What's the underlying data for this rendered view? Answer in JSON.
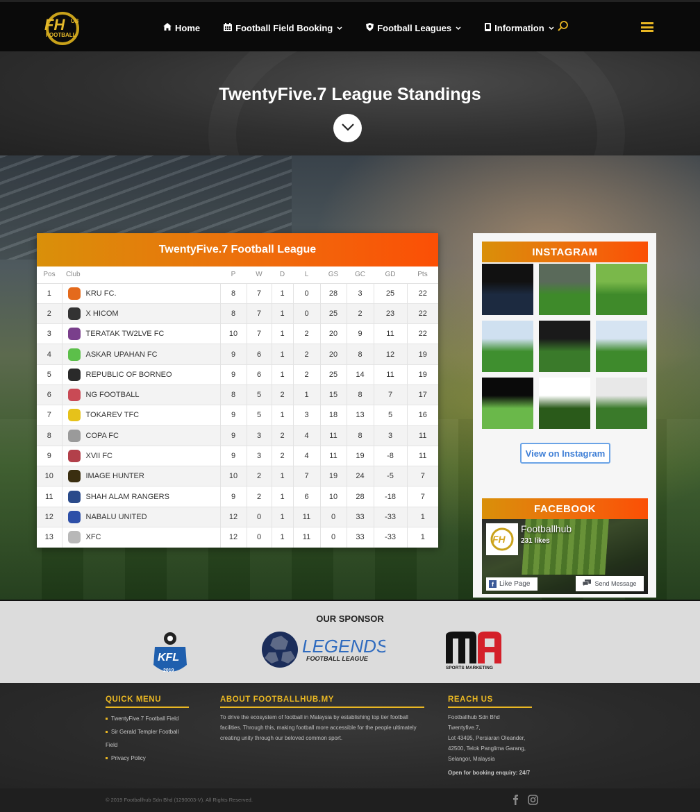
{
  "header": {
    "logo_alt": "Football Hub",
    "nav": [
      {
        "label": "Home",
        "icon": "home-icon",
        "dropdown": false
      },
      {
        "label": "Football Field Booking",
        "icon": "calendar-icon",
        "dropdown": true
      },
      {
        "label": "Football Leagues",
        "icon": "shield-icon",
        "dropdown": true
      },
      {
        "label": "Information",
        "icon": "tablet-icon",
        "dropdown": true
      }
    ],
    "accent": "#e9b723"
  },
  "hero": {
    "title": "TwentyFive.7 League Standings"
  },
  "standings": {
    "title": "TwentyFive.7 Football League",
    "columns": [
      "Pos",
      "Club",
      "P",
      "W",
      "D",
      "L",
      "GS",
      "GC",
      "GD",
      "Pts"
    ],
    "rows": [
      {
        "pos": "1",
        "club": "KRU FC.",
        "p": "8",
        "w": "7",
        "d": "1",
        "l": "0",
        "gs": "28",
        "gc": "3",
        "gd": "25",
        "pts": "22",
        "crest": "#e46a1c"
      },
      {
        "pos": "2",
        "club": "X HICOM",
        "p": "8",
        "w": "7",
        "d": "1",
        "l": "0",
        "gs": "25",
        "gc": "2",
        "gd": "23",
        "pts": "22",
        "crest": "#333333"
      },
      {
        "pos": "3",
        "club": "TERATAK TW2LVE FC",
        "p": "10",
        "w": "7",
        "d": "1",
        "l": "2",
        "gs": "20",
        "gc": "9",
        "gd": "11",
        "pts": "22",
        "crest": "#7a3f8c"
      },
      {
        "pos": "4",
        "club": "ASKAR UPAHAN FC",
        "p": "9",
        "w": "6",
        "d": "1",
        "l": "2",
        "gs": "20",
        "gc": "8",
        "gd": "12",
        "pts": "19",
        "crest": "#5cbf4a"
      },
      {
        "pos": "5",
        "club": "REPUBLIC OF BORNEO",
        "p": "9",
        "w": "6",
        "d": "1",
        "l": "2",
        "gs": "25",
        "gc": "14",
        "gd": "11",
        "pts": "19",
        "crest": "#2a2a2a"
      },
      {
        "pos": "6",
        "club": "NG FOOTBALL",
        "p": "8",
        "w": "5",
        "d": "2",
        "l": "1",
        "gs": "15",
        "gc": "8",
        "gd": "7",
        "pts": "17",
        "crest": "#c94a55"
      },
      {
        "pos": "7",
        "club": "TOKAREV TFC",
        "p": "9",
        "w": "5",
        "d": "1",
        "l": "3",
        "gs": "18",
        "gc": "13",
        "gd": "5",
        "pts": "16",
        "crest": "#e6c21a"
      },
      {
        "pos": "8",
        "club": "COPA FC",
        "p": "9",
        "w": "3",
        "d": "2",
        "l": "4",
        "gs": "11",
        "gc": "8",
        "gd": "3",
        "pts": "11",
        "crest": "#9a9a9a"
      },
      {
        "pos": "9",
        "club": "XVII FC",
        "p": "9",
        "w": "3",
        "d": "2",
        "l": "4",
        "gs": "11",
        "gc": "19",
        "gd": "-8",
        "pts": "11",
        "crest": "#b2404a"
      },
      {
        "pos": "10",
        "club": "IMAGE HUNTER",
        "p": "10",
        "w": "2",
        "d": "1",
        "l": "7",
        "gs": "19",
        "gc": "24",
        "gd": "-5",
        "pts": "7",
        "crest": "#3a2e10"
      },
      {
        "pos": "11",
        "club": "SHAH ALAM RANGERS",
        "p": "9",
        "w": "2",
        "d": "1",
        "l": "6",
        "gs": "10",
        "gc": "28",
        "gd": "-18",
        "pts": "7",
        "crest": "#2a4a8a"
      },
      {
        "pos": "12",
        "club": "NABALU UNITED",
        "p": "12",
        "w": "0",
        "d": "1",
        "l": "11",
        "gs": "0",
        "gc": "33",
        "gd": "-33",
        "pts": "1",
        "crest": "#2d4fa8"
      },
      {
        "pos": "13",
        "club": "XFC",
        "p": "12",
        "w": "0",
        "d": "1",
        "l": "11",
        "gs": "0",
        "gc": "33",
        "gd": "-33",
        "pts": "1",
        "crest": "#b8b8b8"
      }
    ]
  },
  "instagram": {
    "title": "INSTAGRAM",
    "tiles": [
      {
        "label": "promo-poster",
        "colors": [
          "#111",
          "#1c2a40"
        ]
      },
      {
        "label": "field-evening",
        "colors": [
          "#5a6a5a",
          "#3e8a2a"
        ]
      },
      {
        "label": "field-stripes",
        "colors": [
          "#7ab84a",
          "#3f8a2a"
        ]
      },
      {
        "label": "field-day-1",
        "colors": [
          "#cfe0f0",
          "#3f8f2f"
        ]
      },
      {
        "label": "field-night",
        "colors": [
          "#1a1a1a",
          "#3a7a2a"
        ]
      },
      {
        "label": "field-day-2",
        "colors": [
          "#d6e4f2",
          "#3e8a2c"
        ]
      },
      {
        "label": "field-night-lights",
        "colors": [
          "#0a0a0a",
          "#6ab84a"
        ]
      },
      {
        "label": "event-flyer",
        "colors": [
          "#ffffff",
          "#2a5a1a"
        ]
      },
      {
        "label": "field-match",
        "colors": [
          "#e8e8e8",
          "#3a7a2a"
        ]
      }
    ],
    "button_label": "View on Instagram"
  },
  "facebook": {
    "title": "FACEBOOK",
    "page_name": "Footballhub",
    "likes": "231 likes",
    "like_label": "Like Page",
    "send_label": "Send Message"
  },
  "sponsor": {
    "title": "OUR SPONSOR",
    "items": [
      {
        "name": "KFL",
        "sub": "2019"
      },
      {
        "name": "LEGENDS",
        "sub": "FOOTBALL LEAGUE"
      },
      {
        "name": "MA",
        "sub": "SPORTS MARKETING"
      }
    ]
  },
  "footer": {
    "quick_menu": {
      "title": "QUICK MENU",
      "items": [
        "TwentyFive.7 Football Field",
        "Sir Gerald Templer Football Field",
        "Privacy Policy"
      ]
    },
    "about": {
      "title": "ABOUT FOOTBALLHUB.MY",
      "lines": [
        "To drive the ecosystem of football in Malaysia by establishing top tier football",
        "facilities. Through this, making football more accessible for the people ultimately",
        "creating unity through our beloved common sport."
      ]
    },
    "reach": {
      "title": "REACH US",
      "lines": [
        "Footballhub Sdn Bhd Twentyfive.7,",
        "Lot 43495, Persiaran Oleander,",
        "42500, Telok Panglima Garang,",
        "Selangor, Malaysia"
      ],
      "hours": "Open for booking enquiry: 24/7"
    },
    "copyright": "© 2019 Footballhub Sdn Bhd (1290003-V). All Rights Reserved."
  }
}
